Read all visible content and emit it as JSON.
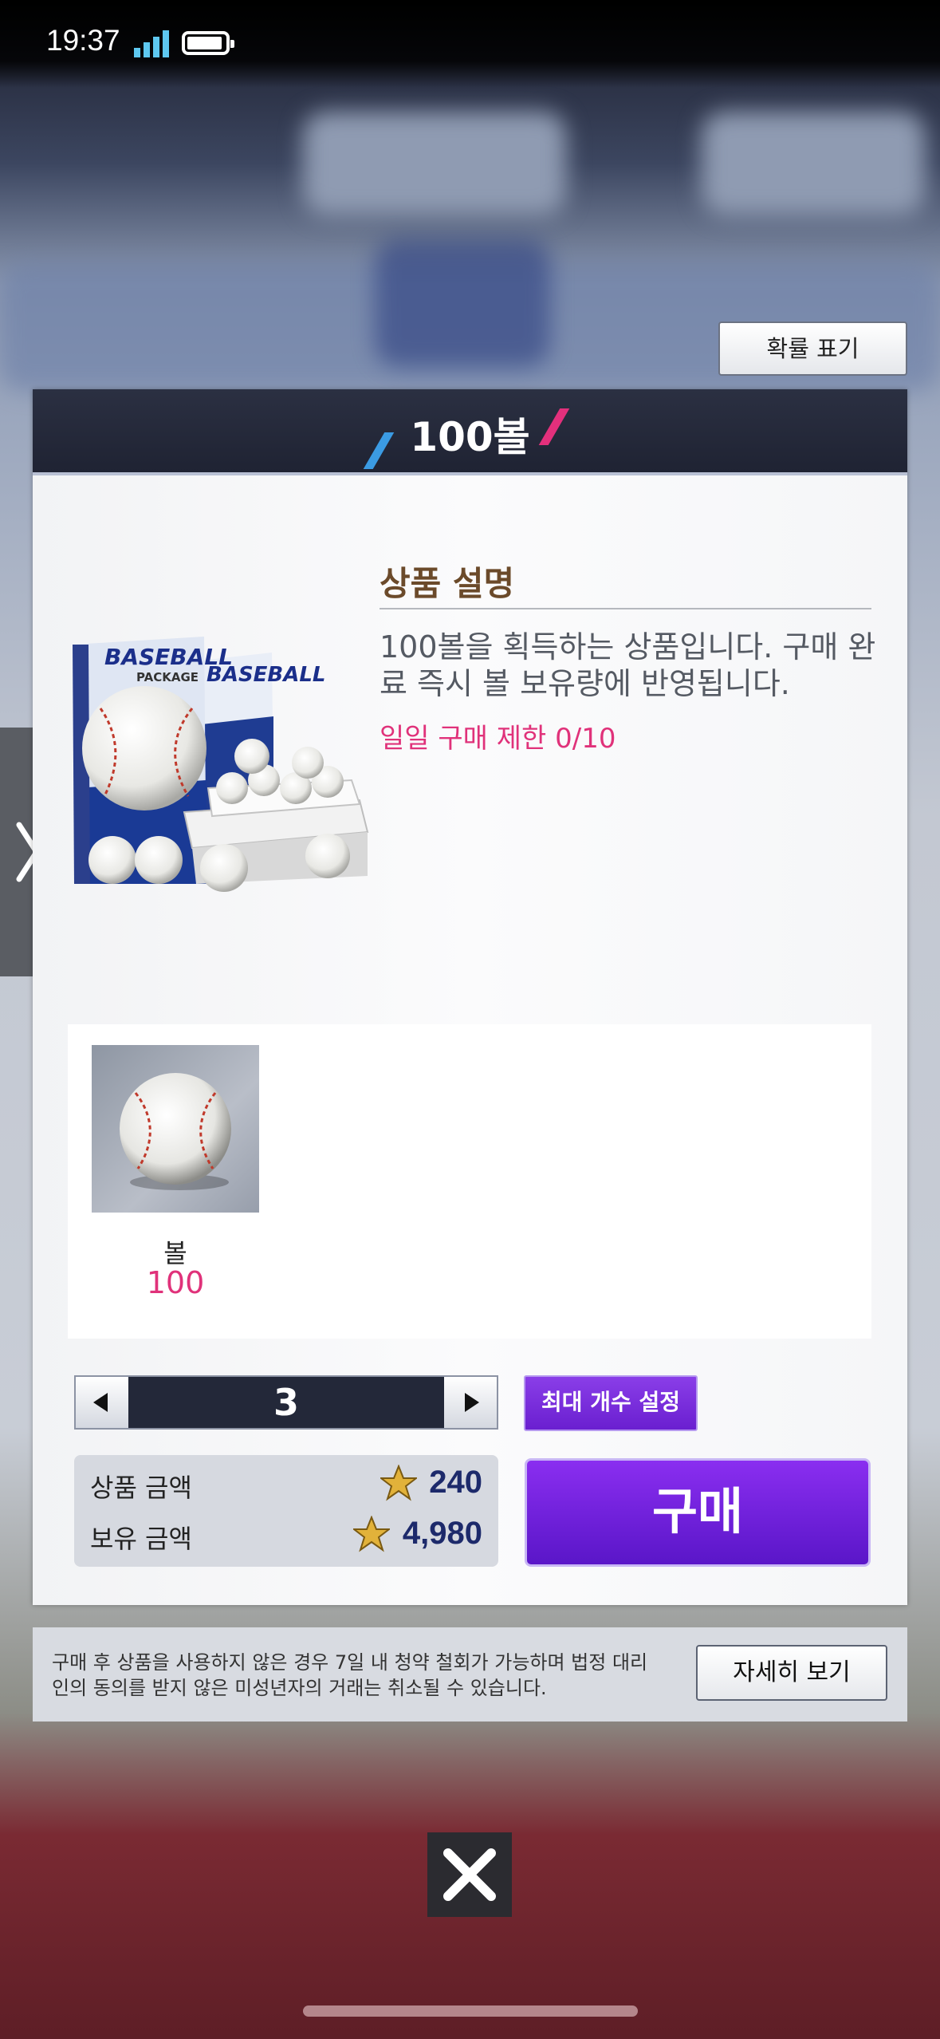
{
  "status_bar": {
    "time": "19:37"
  },
  "top_button": {
    "label": "확률 표기"
  },
  "panel": {
    "title": "100볼",
    "description_title": "상품 설명",
    "description_text": "100볼을 획득하는 상품입니다. 구매 완료 즉시 볼 보유량에 반영됩니다.",
    "limit_text": "일일 구매 제한 0/10",
    "product_image": {
      "brand_text": "BASEBALL",
      "sub_text": "PACKAGE"
    },
    "items": [
      {
        "name": "볼",
        "quantity": "100",
        "icon": "baseball-icon"
      }
    ],
    "quantity": "3",
    "max_button": "최대 개수 설정",
    "price": {
      "label": "상품 금액",
      "value": "240"
    },
    "owned": {
      "label": "보유 금액",
      "value": "4,980"
    },
    "buy_button": "구매"
  },
  "notice": {
    "text": "구매 후 상품을 사용하지 않은 경우 7일 내 청약 철회가 가능하며 법정 대리인의 동의를 받지 않은 미성년자의 거래는 취소될 수 있습니다.",
    "detail_button": "자세히 보기"
  },
  "colors": {
    "accent_purple": "#6a1fd0",
    "accent_pink": "#e0327a",
    "header_navy": "#232839"
  },
  "icons": [
    "signal-icon",
    "battery-icon",
    "chevron-right-icon",
    "star-icon",
    "close-icon",
    "arrow-left-icon",
    "arrow-right-icon"
  ]
}
